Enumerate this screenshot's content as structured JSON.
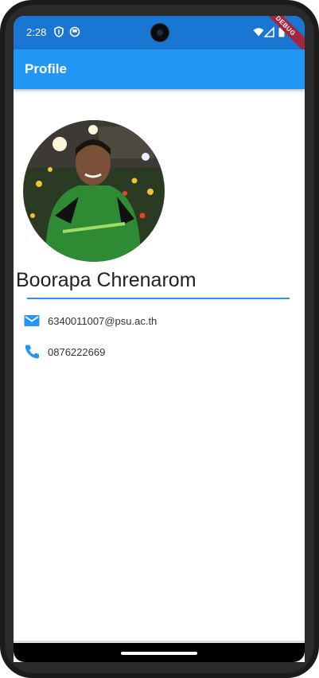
{
  "status_bar": {
    "time": "2:28",
    "debug_label": "DEBUG"
  },
  "app_bar": {
    "title": "Profile"
  },
  "profile": {
    "name": "Boorapa Chrenarom",
    "email": "6340011007@psu.ac.th",
    "phone": "0876222669"
  },
  "colors": {
    "status_bar": "#1976d2",
    "app_bar": "#2196f3",
    "accent": "#2196f3"
  },
  "icons": {
    "email": "email-icon",
    "phone": "phone-icon"
  }
}
